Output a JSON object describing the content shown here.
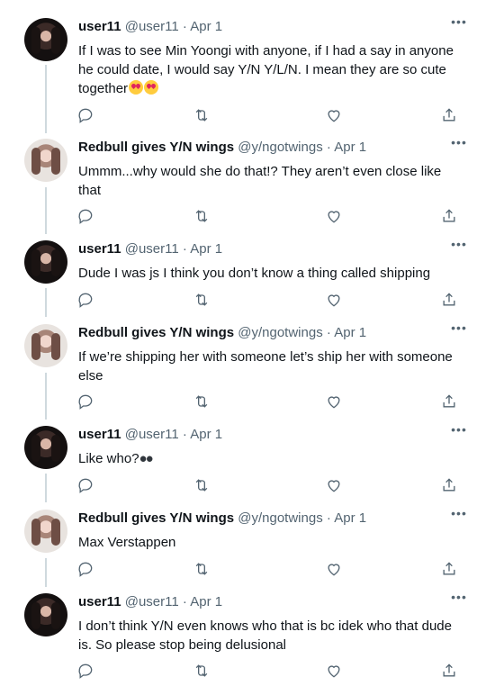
{
  "tweets": [
    {
      "name": "user11",
      "handle": "@user11",
      "dot": "·",
      "date": "Apr 1",
      "text": "If I was to see Min Yoongi with anyone, if I had a say in anyone he could date, I would say Y/N Y/L/N. I mean they are so cute together",
      "emoji": "😍😍",
      "avatar": "dark"
    },
    {
      "name": "Redbull gives Y/N wings",
      "handle": "@y/ngotwings",
      "dot": "·",
      "date": "Apr 1",
      "text": "Ummm...why would she do that!? They aren’t even close like that",
      "avatar": "light"
    },
    {
      "name": "user11",
      "handle": "@user11",
      "dot": "·",
      "date": "Apr 1",
      "text": "Dude I was js I think you don’t know a thing called shipping",
      "avatar": "dark"
    },
    {
      "name": "Redbull gives Y/N wings",
      "handle": "@y/ngotwings",
      "dot": "·",
      "date": "Apr 1",
      "text": "If we’re shipping her with someone let’s ship her with someone else",
      "avatar": "light"
    },
    {
      "name": "user11",
      "handle": "@user11",
      "dot": "·",
      "date": "Apr 1",
      "text": "Like who?",
      "emoji": "👀",
      "avatar": "dark"
    },
    {
      "name": "Redbull gives Y/N wings",
      "handle": "@y/ngotwings",
      "dot": "·",
      "date": "Apr 1",
      "text": "Max Verstappen",
      "avatar": "light"
    },
    {
      "name": "user11",
      "handle": "@user11",
      "dot": "·",
      "date": "Apr 1",
      "text": "I don’t think Y/N even knows who that is bc idek who that dude is. So please stop being delusional",
      "avatar": "dark"
    }
  ],
  "icons": {
    "more": "more-icon",
    "reply": "reply-icon",
    "retweet": "retweet-icon",
    "like": "heart-icon",
    "share": "share-icon"
  },
  "colors": {
    "text": "#0f1419",
    "secondary": "#536471",
    "thread_line": "#cfd9de"
  }
}
